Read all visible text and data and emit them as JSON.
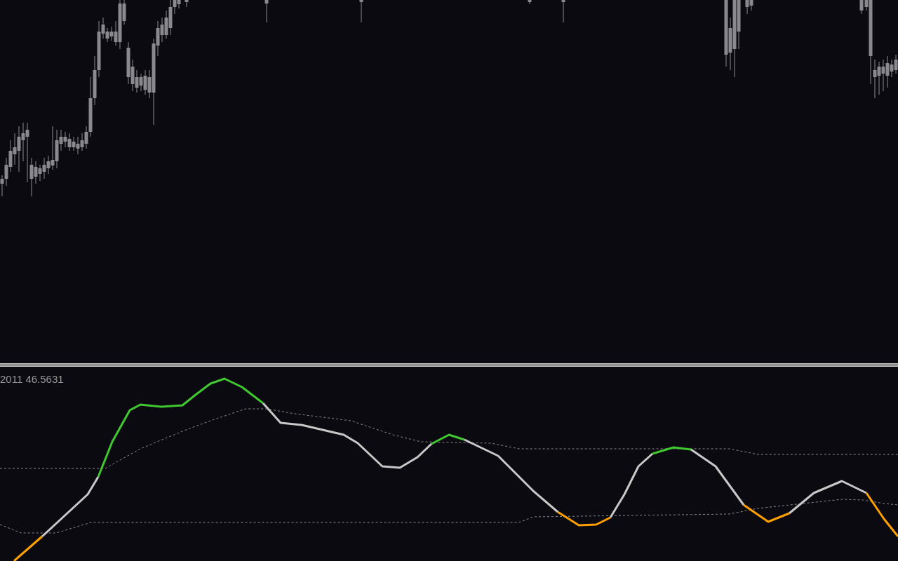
{
  "indicator_pane": {
    "label": "2011 46.5631"
  }
}
